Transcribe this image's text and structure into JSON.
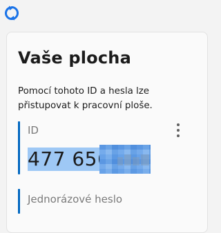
{
  "app": {
    "logo_icon": "anydesk-style-circular-arrows-icon",
    "accent_color": "#0067c0"
  },
  "panel": {
    "title": "Vaše plocha",
    "description": "Pomocí tohoto ID a hesla lze přistupovat k pracovní ploše.",
    "id_section": {
      "label": "ID",
      "value": "477 656",
      "menu_icon": "more-vertical-icon"
    },
    "password_section": {
      "label": "Jednorázové heslo"
    }
  }
}
